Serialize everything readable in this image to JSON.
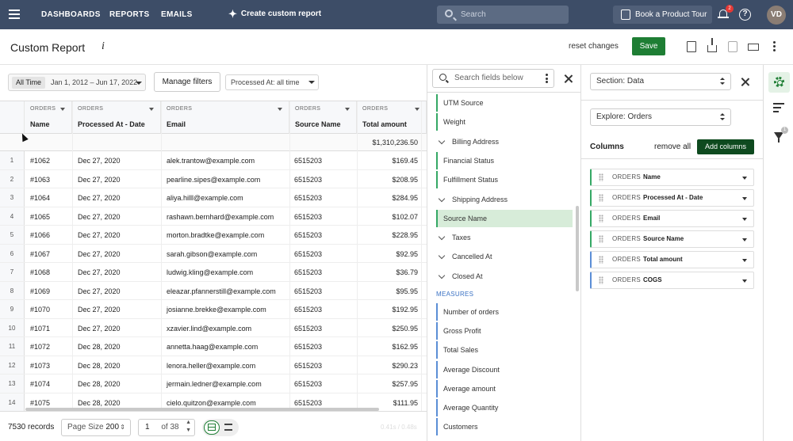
{
  "nav": {
    "links": [
      "DASHBOARDS",
      "REPORTS",
      "EMAILS"
    ],
    "create_label": "Create custom report",
    "search_placeholder": "Search",
    "tour_label": "Book a Product Tour",
    "notification_count": "2",
    "help_label": "?",
    "avatar_initials": "VD"
  },
  "header": {
    "title": "Custom Report",
    "info_label": "i",
    "reset_label": "reset changes",
    "save_label": "Save"
  },
  "filters": {
    "range_chip": "All Time",
    "range_text": "Jan 1, 2012 – Jun 17, 2022",
    "manage_label": "Manage filters",
    "processed_label": "Processed At: all time"
  },
  "grid": {
    "columns": [
      {
        "group": "ORDERS",
        "name": "Name"
      },
      {
        "group": "ORDERS",
        "name": "Processed At - Date"
      },
      {
        "group": "ORDERS",
        "name": "Email"
      },
      {
        "group": "ORDERS",
        "name": "Source Name"
      },
      {
        "group": "ORDERS",
        "name": "Total amount"
      }
    ],
    "total_amount": "$1,310,236.50",
    "rows": [
      {
        "n": "1",
        "name": "#1062",
        "date": "Dec 27, 2020",
        "email": "alek.trantow@example.com",
        "source": "6515203",
        "total": "$169.45"
      },
      {
        "n": "2",
        "name": "#1063",
        "date": "Dec 27, 2020",
        "email": "pearline.sipes@example.com",
        "source": "6515203",
        "total": "$208.95"
      },
      {
        "n": "3",
        "name": "#1064",
        "date": "Dec 27, 2020",
        "email": "aliya.hilll@example.com",
        "source": "6515203",
        "total": "$284.95"
      },
      {
        "n": "4",
        "name": "#1065",
        "date": "Dec 27, 2020",
        "email": "rashawn.bernhard@example.com",
        "source": "6515203",
        "total": "$102.07"
      },
      {
        "n": "5",
        "name": "#1066",
        "date": "Dec 27, 2020",
        "email": "morton.bradtke@example.com",
        "source": "6515203",
        "total": "$228.95"
      },
      {
        "n": "6",
        "name": "#1067",
        "date": "Dec 27, 2020",
        "email": "sarah.gibson@example.com",
        "source": "6515203",
        "total": "$92.95"
      },
      {
        "n": "7",
        "name": "#1068",
        "date": "Dec 27, 2020",
        "email": "ludwig.kling@example.com",
        "source": "6515203",
        "total": "$36.79"
      },
      {
        "n": "8",
        "name": "#1069",
        "date": "Dec 27, 2020",
        "email": "eleazar.pfannerstill@example.com",
        "source": "6515203",
        "total": "$95.95"
      },
      {
        "n": "9",
        "name": "#1070",
        "date": "Dec 27, 2020",
        "email": "josianne.brekke@example.com",
        "source": "6515203",
        "total": "$192.95"
      },
      {
        "n": "10",
        "name": "#1071",
        "date": "Dec 27, 2020",
        "email": "xzavier.lind@example.com",
        "source": "6515203",
        "total": "$250.95"
      },
      {
        "n": "11",
        "name": "#1072",
        "date": "Dec 28, 2020",
        "email": "annetta.haag@example.com",
        "source": "6515203",
        "total": "$162.95"
      },
      {
        "n": "12",
        "name": "#1073",
        "date": "Dec 28, 2020",
        "email": "lenora.heller@example.com",
        "source": "6515203",
        "total": "$290.23"
      },
      {
        "n": "13",
        "name": "#1074",
        "date": "Dec 28, 2020",
        "email": "jermain.ledner@example.com",
        "source": "6515203",
        "total": "$257.95"
      },
      {
        "n": "14",
        "name": "#1075",
        "date": "Dec 28, 2020",
        "email": "cielo.quitzon@example.com",
        "source": "6515203",
        "total": "$111.95"
      }
    ]
  },
  "footer": {
    "records": "7530 records",
    "page_size_label": "Page Size",
    "page_size_value": "200",
    "page_current": "1",
    "page_of": "of 38",
    "timing": "0.41s / 0.48s"
  },
  "fields": {
    "search_placeholder": "Search fields below",
    "items": [
      {
        "label": "UTM Source",
        "kind": "dim"
      },
      {
        "label": "Weight",
        "kind": "dim"
      },
      {
        "label": "Billing Address",
        "kind": "group"
      },
      {
        "label": "Financial Status",
        "kind": "dim"
      },
      {
        "label": "Fulfillment Status",
        "kind": "dim"
      },
      {
        "label": "Shipping Address",
        "kind": "group"
      },
      {
        "label": "Source Name",
        "kind": "selected"
      },
      {
        "label": "Taxes",
        "kind": "group"
      },
      {
        "label": "Cancelled At",
        "kind": "group"
      },
      {
        "label": "Closed At",
        "kind": "group"
      }
    ],
    "measures_label": "MEASURES",
    "measures": [
      "Number of orders",
      "Gross Profit",
      "Total Sales",
      "Average Discount",
      "Average amount",
      "Average Quantity",
      "Customers"
    ]
  },
  "config": {
    "section_label": "Section: Data",
    "explore_label": "Explore: Orders",
    "columns_label": "Columns",
    "remove_all_label": "remove all",
    "add_columns_label": "Add columns",
    "columns": [
      {
        "group": "ORDERS",
        "name": "Name",
        "kind": "dim"
      },
      {
        "group": "ORDERS",
        "name": "Processed At - Date",
        "kind": "dim"
      },
      {
        "group": "ORDERS",
        "name": "Email",
        "kind": "dim"
      },
      {
        "group": "ORDERS",
        "name": "Source Name",
        "kind": "dim"
      },
      {
        "group": "ORDERS",
        "name": "Total amount",
        "kind": "meas"
      },
      {
        "group": "ORDERS",
        "name": "COGS",
        "kind": "meas"
      }
    ]
  },
  "rail": {
    "filter_count": "1"
  },
  "colors": {
    "nav_bg": "#3d4d67",
    "save_green": "#1e7e34",
    "dimension_green": "#35a865",
    "measure_blue": "#5b8ed6",
    "selected_bg": "#d7ecd9"
  }
}
